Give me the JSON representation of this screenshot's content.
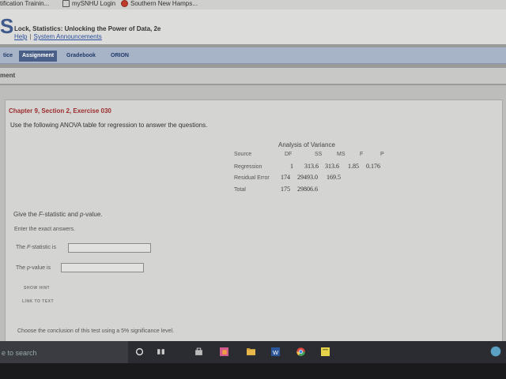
{
  "bookmarks": [
    "tification Trainin...",
    "mySNHU Login",
    "Southern New Hamps..."
  ],
  "header": {
    "logo": "S",
    "book_title": "Lock, Statistics: Unlocking the Power of Data, 2e",
    "help": "Help",
    "sep": "|",
    "announcements": "System Announcements"
  },
  "nav": {
    "tabs": [
      "tice",
      "Assignment",
      "Gradebook",
      "ORION"
    ],
    "active": "Assignment"
  },
  "subheader": "ment",
  "exercise": {
    "chapter": "Chapter 9, Section 2, Exercise 030",
    "instructions": "Use the following ANOVA table for regression to answer the questions."
  },
  "anova": {
    "title": "Analysis of Variance",
    "headers": [
      "Source",
      "DF",
      "SS",
      "MS",
      "F",
      "P"
    ],
    "rows": [
      [
        "Regression",
        "1",
        "313.6",
        "313.6",
        "1.85",
        "0.176"
      ],
      [
        "Residual Error",
        "174",
        "29493.0",
        "169.5",
        "",
        ""
      ],
      [
        "Total",
        "175",
        "29806.6",
        "",
        "",
        ""
      ]
    ]
  },
  "questions": {
    "q1_prefix": "Give the ",
    "q1_f": "F",
    "q1_mid": "-statistic and ",
    "q1_p": "p",
    "q1_suffix": "-value.",
    "enter_exact": "Enter the exact answers.",
    "f_label_prefix": "The ",
    "f_label_f": "F",
    "f_label_suffix": "-statistic is",
    "p_label_prefix": "The ",
    "p_label_p": "p",
    "p_label_suffix": "-value is",
    "show_hint": "SHOW HINT",
    "link_to_text": "LINK TO TEXT",
    "conclusion": "Choose the conclusion of this test using a 5% significance level.",
    "f_value": "",
    "p_value": ""
  },
  "taskbar": {
    "search_text": "e to search",
    "icons": [
      "cortana-icon",
      "task-view-icon",
      "store-icon",
      "photos-icon",
      "file-explorer-icon",
      "word-icon",
      "chrome-icon",
      "sticky-notes-icon"
    ]
  }
}
